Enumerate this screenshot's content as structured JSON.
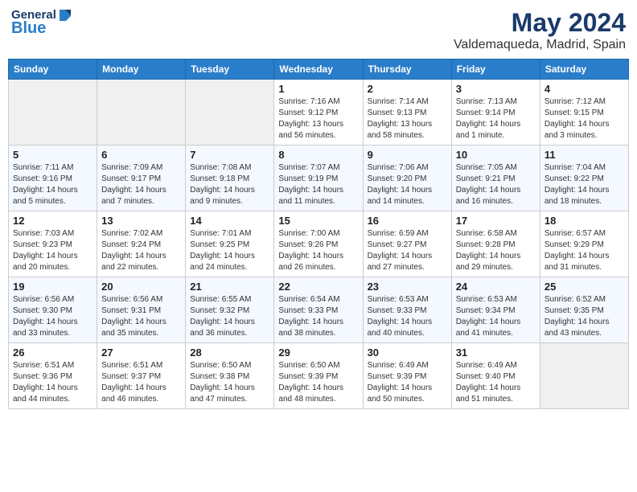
{
  "header": {
    "logo_general": "General",
    "logo_blue": "Blue",
    "title": "May 2024",
    "subtitle": "Valdemaqueda, Madrid, Spain"
  },
  "days_of_week": [
    "Sunday",
    "Monday",
    "Tuesday",
    "Wednesday",
    "Thursday",
    "Friday",
    "Saturday"
  ],
  "weeks": [
    [
      {
        "date": "",
        "empty": true
      },
      {
        "date": "",
        "empty": true
      },
      {
        "date": "",
        "empty": true
      },
      {
        "date": "1",
        "sunrise": "Sunrise: 7:16 AM",
        "sunset": "Sunset: 9:12 PM",
        "daylight": "Daylight: 13 hours and 56 minutes."
      },
      {
        "date": "2",
        "sunrise": "Sunrise: 7:14 AM",
        "sunset": "Sunset: 9:13 PM",
        "daylight": "Daylight: 13 hours and 58 minutes."
      },
      {
        "date": "3",
        "sunrise": "Sunrise: 7:13 AM",
        "sunset": "Sunset: 9:14 PM",
        "daylight": "Daylight: 14 hours and 1 minute."
      },
      {
        "date": "4",
        "sunrise": "Sunrise: 7:12 AM",
        "sunset": "Sunset: 9:15 PM",
        "daylight": "Daylight: 14 hours and 3 minutes."
      }
    ],
    [
      {
        "date": "5",
        "sunrise": "Sunrise: 7:11 AM",
        "sunset": "Sunset: 9:16 PM",
        "daylight": "Daylight: 14 hours and 5 minutes."
      },
      {
        "date": "6",
        "sunrise": "Sunrise: 7:09 AM",
        "sunset": "Sunset: 9:17 PM",
        "daylight": "Daylight: 14 hours and 7 minutes."
      },
      {
        "date": "7",
        "sunrise": "Sunrise: 7:08 AM",
        "sunset": "Sunset: 9:18 PM",
        "daylight": "Daylight: 14 hours and 9 minutes."
      },
      {
        "date": "8",
        "sunrise": "Sunrise: 7:07 AM",
        "sunset": "Sunset: 9:19 PM",
        "daylight": "Daylight: 14 hours and 11 minutes."
      },
      {
        "date": "9",
        "sunrise": "Sunrise: 7:06 AM",
        "sunset": "Sunset: 9:20 PM",
        "daylight": "Daylight: 14 hours and 14 minutes."
      },
      {
        "date": "10",
        "sunrise": "Sunrise: 7:05 AM",
        "sunset": "Sunset: 9:21 PM",
        "daylight": "Daylight: 14 hours and 16 minutes."
      },
      {
        "date": "11",
        "sunrise": "Sunrise: 7:04 AM",
        "sunset": "Sunset: 9:22 PM",
        "daylight": "Daylight: 14 hours and 18 minutes."
      }
    ],
    [
      {
        "date": "12",
        "sunrise": "Sunrise: 7:03 AM",
        "sunset": "Sunset: 9:23 PM",
        "daylight": "Daylight: 14 hours and 20 minutes."
      },
      {
        "date": "13",
        "sunrise": "Sunrise: 7:02 AM",
        "sunset": "Sunset: 9:24 PM",
        "daylight": "Daylight: 14 hours and 22 minutes."
      },
      {
        "date": "14",
        "sunrise": "Sunrise: 7:01 AM",
        "sunset": "Sunset: 9:25 PM",
        "daylight": "Daylight: 14 hours and 24 minutes."
      },
      {
        "date": "15",
        "sunrise": "Sunrise: 7:00 AM",
        "sunset": "Sunset: 9:26 PM",
        "daylight": "Daylight: 14 hours and 26 minutes."
      },
      {
        "date": "16",
        "sunrise": "Sunrise: 6:59 AM",
        "sunset": "Sunset: 9:27 PM",
        "daylight": "Daylight: 14 hours and 27 minutes."
      },
      {
        "date": "17",
        "sunrise": "Sunrise: 6:58 AM",
        "sunset": "Sunset: 9:28 PM",
        "daylight": "Daylight: 14 hours and 29 minutes."
      },
      {
        "date": "18",
        "sunrise": "Sunrise: 6:57 AM",
        "sunset": "Sunset: 9:29 PM",
        "daylight": "Daylight: 14 hours and 31 minutes."
      }
    ],
    [
      {
        "date": "19",
        "sunrise": "Sunrise: 6:56 AM",
        "sunset": "Sunset: 9:30 PM",
        "daylight": "Daylight: 14 hours and 33 minutes."
      },
      {
        "date": "20",
        "sunrise": "Sunrise: 6:56 AM",
        "sunset": "Sunset: 9:31 PM",
        "daylight": "Daylight: 14 hours and 35 minutes."
      },
      {
        "date": "21",
        "sunrise": "Sunrise: 6:55 AM",
        "sunset": "Sunset: 9:32 PM",
        "daylight": "Daylight: 14 hours and 36 minutes."
      },
      {
        "date": "22",
        "sunrise": "Sunrise: 6:54 AM",
        "sunset": "Sunset: 9:33 PM",
        "daylight": "Daylight: 14 hours and 38 minutes."
      },
      {
        "date": "23",
        "sunrise": "Sunrise: 6:53 AM",
        "sunset": "Sunset: 9:33 PM",
        "daylight": "Daylight: 14 hours and 40 minutes."
      },
      {
        "date": "24",
        "sunrise": "Sunrise: 6:53 AM",
        "sunset": "Sunset: 9:34 PM",
        "daylight": "Daylight: 14 hours and 41 minutes."
      },
      {
        "date": "25",
        "sunrise": "Sunrise: 6:52 AM",
        "sunset": "Sunset: 9:35 PM",
        "daylight": "Daylight: 14 hours and 43 minutes."
      }
    ],
    [
      {
        "date": "26",
        "sunrise": "Sunrise: 6:51 AM",
        "sunset": "Sunset: 9:36 PM",
        "daylight": "Daylight: 14 hours and 44 minutes."
      },
      {
        "date": "27",
        "sunrise": "Sunrise: 6:51 AM",
        "sunset": "Sunset: 9:37 PM",
        "daylight": "Daylight: 14 hours and 46 minutes."
      },
      {
        "date": "28",
        "sunrise": "Sunrise: 6:50 AM",
        "sunset": "Sunset: 9:38 PM",
        "daylight": "Daylight: 14 hours and 47 minutes."
      },
      {
        "date": "29",
        "sunrise": "Sunrise: 6:50 AM",
        "sunset": "Sunset: 9:39 PM",
        "daylight": "Daylight: 14 hours and 48 minutes."
      },
      {
        "date": "30",
        "sunrise": "Sunrise: 6:49 AM",
        "sunset": "Sunset: 9:39 PM",
        "daylight": "Daylight: 14 hours and 50 minutes."
      },
      {
        "date": "31",
        "sunrise": "Sunrise: 6:49 AM",
        "sunset": "Sunset: 9:40 PM",
        "daylight": "Daylight: 14 hours and 51 minutes."
      },
      {
        "date": "",
        "empty": true
      }
    ]
  ]
}
